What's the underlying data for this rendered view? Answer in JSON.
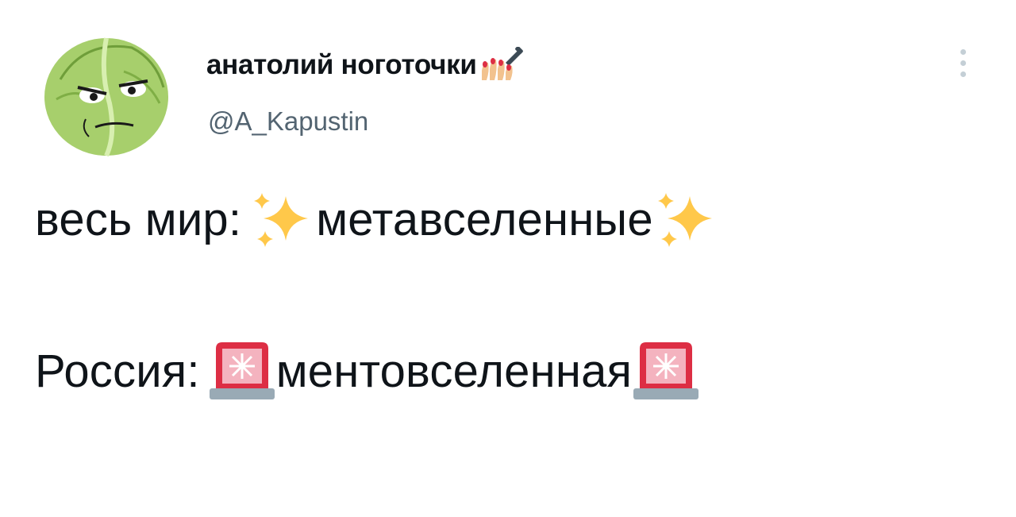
{
  "author": {
    "display_name": "анатолий ноготочки",
    "display_name_emoji": "nail-polish-icon",
    "username": "@A_Kapustin",
    "avatar": "cabbage-avatar-icon"
  },
  "tweet": {
    "line1_prefix": "весь мир: ",
    "line1_word": "метавселенные",
    "line1_emoji": "sparkles-icon",
    "line2_prefix": "Россия: ",
    "line2_word": "ментовселенная",
    "line2_emoji": "police-siren-icon"
  },
  "actions": {
    "more_icon": "more-options-icon"
  },
  "colors": {
    "text": "#0f1419",
    "muted": "#536471",
    "sparkle": "#ffc84a",
    "siren": "#dd2e44"
  }
}
